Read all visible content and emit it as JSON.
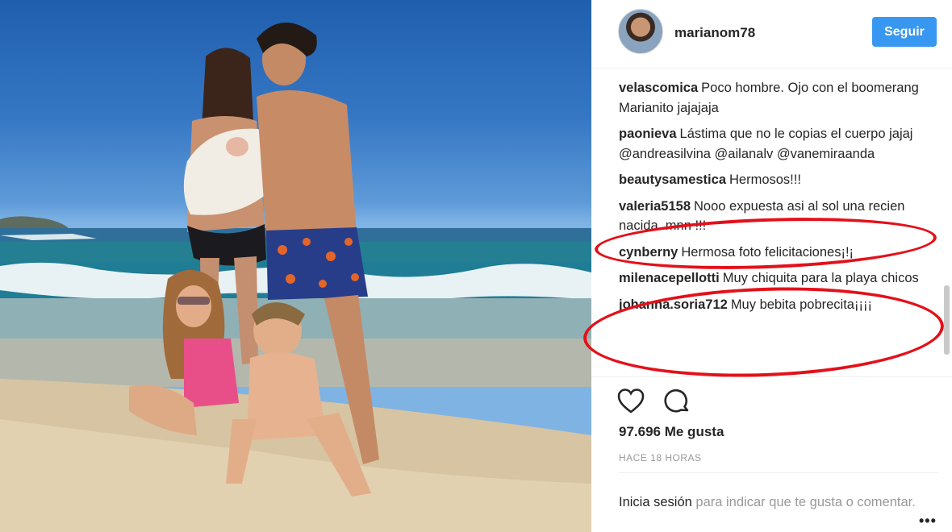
{
  "post": {
    "photo_alt": "Family on the beach"
  },
  "header": {
    "username": "marianom78",
    "follow_label": "Seguir"
  },
  "comments": [
    {
      "user": "velascomica",
      "text": "Poco hombre. Ojo con el boomerang Marianito jajajaja"
    },
    {
      "user": "paonieva",
      "text": "Lástima que no le copias el cuerpo jajaj @andreasilvina @ailanalv @vanemiraanda"
    },
    {
      "user": "beautysamestica",
      "text": "Hermosos!!!"
    },
    {
      "user": "valeria5158",
      "text": "Nooo expuesta asi al sol una recien nacida..mnn !!!"
    },
    {
      "user": "cynberny",
      "text": "Hermosa foto felicitaciones¡!¡"
    },
    {
      "user": "milenacepellotti",
      "text": "Muy chiquita para la playa chicos"
    },
    {
      "user": "johanna.soria712",
      "text": "Muy bebita pobrecita¡¡¡¡"
    }
  ],
  "actions": {
    "heart_icon": "heart-icon",
    "comment_icon": "comment-icon",
    "likes": "97.696 Me gusta",
    "time": "HACE 18 HORAS"
  },
  "login": {
    "link": "Inicia sesión",
    "text": " para indicar que te gusta o comentar."
  },
  "more": "•••",
  "colors": {
    "follow_button": "#3897f0",
    "annotation": "#e3101a"
  }
}
